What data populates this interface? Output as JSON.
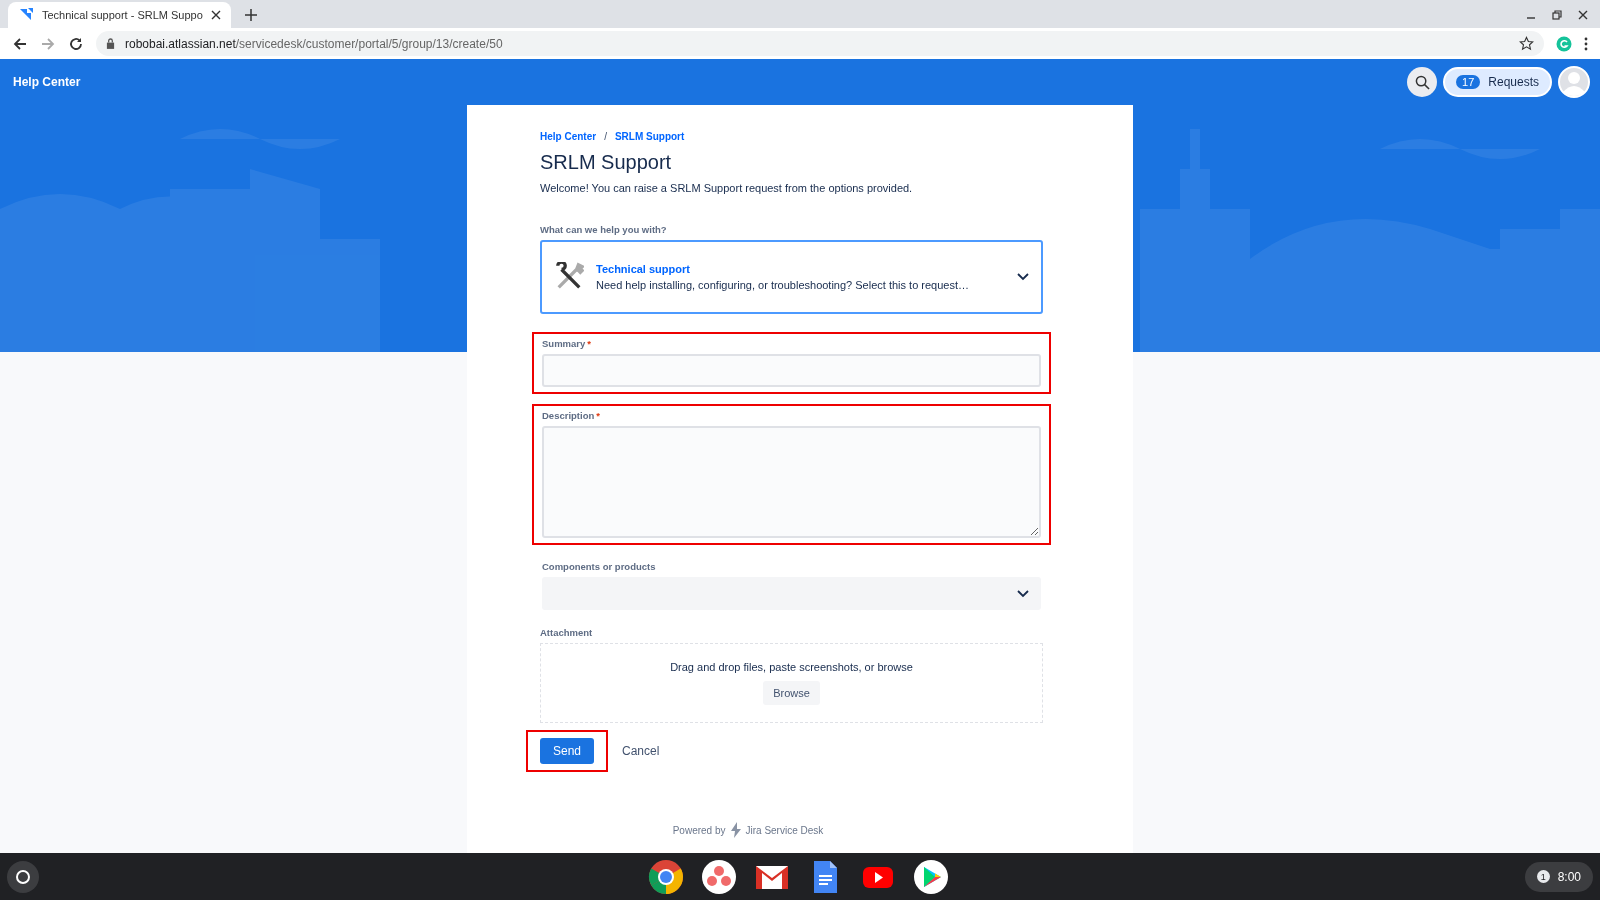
{
  "browser": {
    "tab_title": "Technical support - SRLM Suppo",
    "url_host": "robobai.atlassian.net",
    "url_path": "/servicedesk/customer/portal/5/group/13/create/50"
  },
  "header": {
    "title": "Help Center",
    "requests_count": "17",
    "requests_label": "Requests"
  },
  "breadcrumbs": [
    "Help Center",
    "SRLM Support"
  ],
  "breadcrumb_separator": "/",
  "page_title": "SRLM Support",
  "welcome": "Welcome! You can raise a SRLM Support request from the options provided.",
  "request_type": {
    "label": "What can we help you with?",
    "title": "Technical support",
    "description": "Need help installing, configuring, or troubleshooting? Select this to request…"
  },
  "fields": [
    {
      "kind": "text",
      "label": "Summary",
      "required_mark": "*",
      "highlighted": true
    },
    {
      "kind": "textarea",
      "label": "Description",
      "required_mark": "*",
      "highlighted": true
    },
    {
      "kind": "select",
      "label": "Components or products",
      "highlighted": false
    }
  ],
  "attachment": {
    "label": "Attachment",
    "hint": "Drag and drop files, paste screenshots, or browse",
    "button": "Browse"
  },
  "actions": {
    "send": "Send",
    "send_highlighted": true,
    "cancel": "Cancel"
  },
  "footer": {
    "powered_by": "Powered by",
    "product": "Jira Service Desk"
  },
  "taskbar": {
    "notifications": "1",
    "time": "8:00"
  }
}
